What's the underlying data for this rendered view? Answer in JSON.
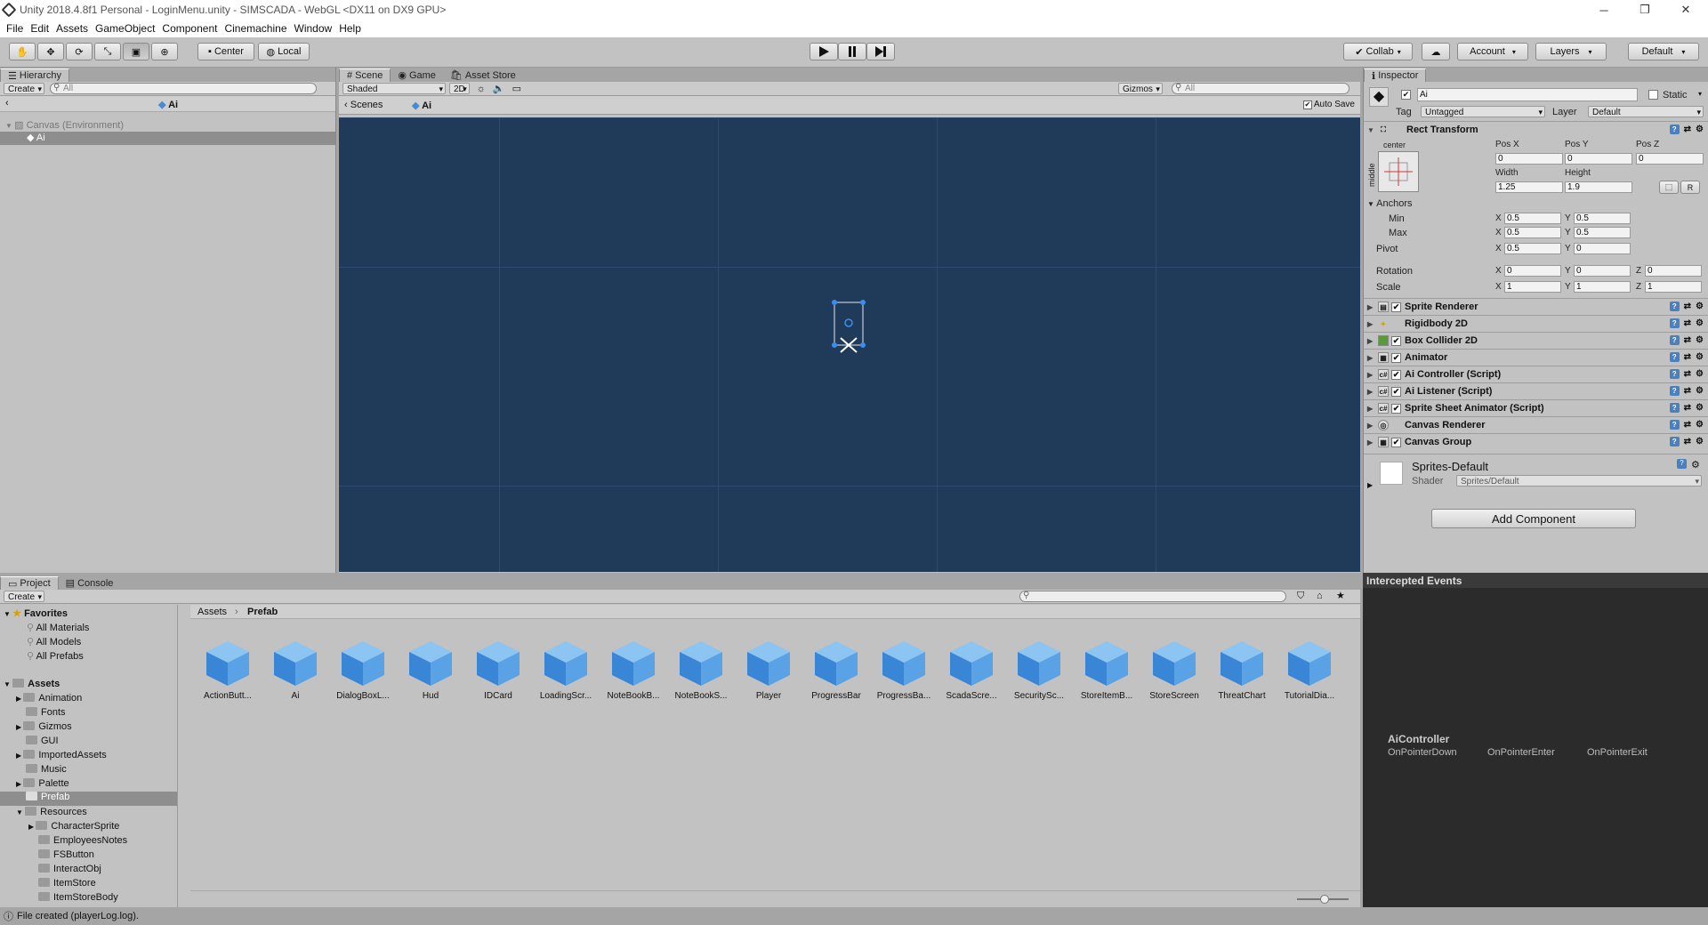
{
  "window": {
    "title": "Unity 2018.4.8f1 Personal - LoginMenu.unity - SIMSCADA - WebGL <DX11 on DX9 GPU>"
  },
  "menu": [
    "File",
    "Edit",
    "Assets",
    "GameObject",
    "Component",
    "Cinemachine",
    "Window",
    "Help"
  ],
  "toolbar": {
    "center_label": "Center",
    "local_label": "Local",
    "collab_label": "Collab",
    "account_label": "Account",
    "layers_label": "Layers",
    "layout_label": "Default"
  },
  "hierarchy": {
    "tab": "Hierarchy",
    "create": "Create",
    "search_placeholder": "All",
    "header_title": "Ai",
    "root": "Canvas (Environment)",
    "child": "Ai"
  },
  "scene": {
    "tabs": [
      "Scene",
      "Game",
      "Asset Store"
    ],
    "shading": "Shaded",
    "mode_2d": "2D",
    "gizmos": "Gizmos",
    "search_placeholder": "All",
    "breadcrumb_root": "Scenes",
    "breadcrumb_item": "Ai",
    "autosave_label": "Auto Save"
  },
  "inspector": {
    "tab": "Inspector",
    "object_name": "Ai",
    "static_label": "Static",
    "tag_label": "Tag",
    "tag_value": "Untagged",
    "layer_label": "Layer",
    "layer_value": "Default",
    "rect_transform": "Rect Transform",
    "anchor_h": "center",
    "anchor_v": "middle",
    "pos_x_label": "Pos X",
    "pos_y_label": "Pos Y",
    "pos_z_label": "Pos Z",
    "pos_x": "0",
    "pos_y": "0",
    "pos_z": "0",
    "width_label": "Width",
    "height_label": "Height",
    "width": "1.25",
    "height": "1.9",
    "r_label": "R",
    "anchors_label": "Anchors",
    "min_label": "Min",
    "max_label": "Max",
    "pivot_label": "Pivot",
    "x_label": "X",
    "y_label": "Y",
    "z_label": "Z",
    "anchor_min_x": "0.5",
    "anchor_min_y": "0.5",
    "anchor_max_x": "0.5",
    "anchor_max_y": "0.5",
    "pivot_x": "0.5",
    "pivot_y": "0",
    "rotation_label": "Rotation",
    "rot_x": "0",
    "rot_y": "0",
    "rot_z": "0",
    "scale_label": "Scale",
    "scale_x": "1",
    "scale_y": "1",
    "scale_z": "1",
    "components": [
      "Sprite Renderer",
      "Rigidbody 2D",
      "Box Collider 2D",
      "Animator",
      "Ai Controller (Script)",
      "Ai Listener (Script)",
      "Sprite Sheet Animator (Script)",
      "Canvas Renderer",
      "Canvas Group"
    ],
    "material_name": "Sprites-Default",
    "shader_label": "Shader",
    "shader_value": "Sprites/Default",
    "add_component": "Add Component"
  },
  "project": {
    "tabs": [
      "Project",
      "Console"
    ],
    "create": "Create",
    "favorites_label": "Favorites",
    "favorites": [
      "All Materials",
      "All Models",
      "All Prefabs"
    ],
    "assets_label": "Assets",
    "folders": [
      "Animation",
      "Fonts",
      "Gizmos",
      "GUI",
      "ImportedAssets",
      "Music",
      "Palette",
      "Prefab",
      "Resources"
    ],
    "resources_children": [
      "CharacterSprite",
      "EmployeesNotes",
      "FSButton",
      "InteractObj",
      "ItemStore",
      "ItemStoreBody"
    ],
    "breadcrumb_root": "Assets",
    "breadcrumb_current": "Prefab",
    "prefabs": [
      "ActionButt...",
      "Ai",
      "DialogBoxL...",
      "Hud",
      "IDCard",
      "LoadingScr...",
      "NoteBookB...",
      "NoteBookS...",
      "Player",
      "ProgressBar",
      "ProgressBa...",
      "ScadaScre...",
      "SecuritySc...",
      "StoreItemB...",
      "StoreScreen",
      "ThreatChart",
      "TutorialDia..."
    ]
  },
  "events": {
    "title": "Intercepted Events",
    "controller": "AiController",
    "events": [
      "OnPointerDown",
      "OnPointerEnter",
      "OnPointerExit"
    ]
  },
  "status": {
    "text": "File created (playerLog.log)."
  }
}
